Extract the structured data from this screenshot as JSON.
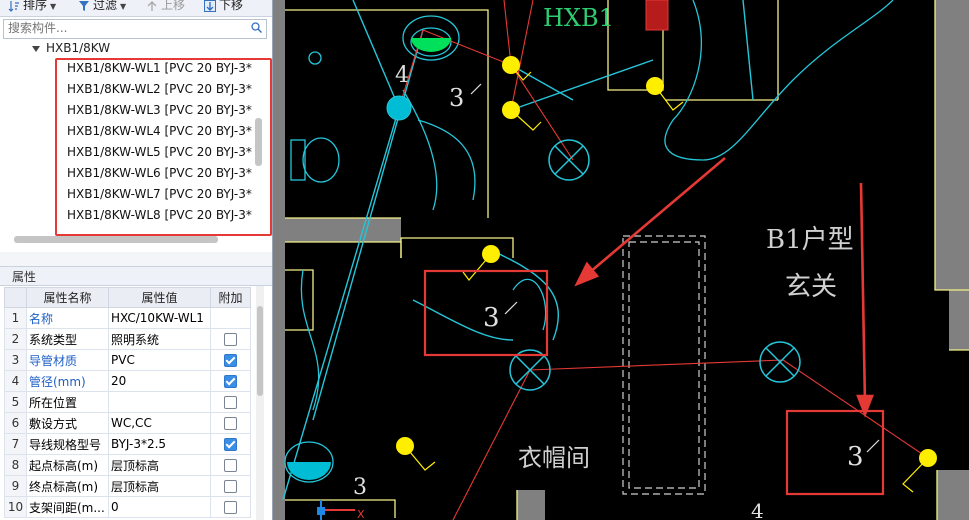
{
  "toolbar": {
    "sort_label": "排序",
    "filter_label": "过滤",
    "move_up_label": "上移",
    "move_down_label": "下移"
  },
  "search": {
    "placeholder": "搜索构件..."
  },
  "tree": {
    "root_label": "HXB1/8KW",
    "items": [
      {
        "label": "HXB1/8KW-WL1 [PVC 20 BYJ-3*"
      },
      {
        "label": "HXB1/8KW-WL2 [PVC 20 BYJ-3*"
      },
      {
        "label": "HXB1/8KW-WL3 [PVC 20 BYJ-3*"
      },
      {
        "label": "HXB1/8KW-WL4 [PVC 20 BYJ-3*"
      },
      {
        "label": "HXB1/8KW-WL5 [PVC 20 BYJ-3*"
      },
      {
        "label": "HXB1/8KW-WL6 [PVC 20 BYJ-3*"
      },
      {
        "label": "HXB1/8KW-WL7 [PVC 20 BYJ-3*"
      },
      {
        "label": "HXB1/8KW-WL8 [PVC 20 BYJ-3*"
      }
    ]
  },
  "properties": {
    "panel_title": "属性",
    "columns": [
      "属性名称",
      "属性值",
      "附加"
    ],
    "rows": [
      {
        "num": "1",
        "name": "名称",
        "value": "HXC/10KW-WL1",
        "checked": null,
        "blue": true
      },
      {
        "num": "2",
        "name": "系统类型",
        "value": "照明系统",
        "checked": false,
        "blue": false
      },
      {
        "num": "3",
        "name": "导管材质",
        "value": "PVC",
        "checked": true,
        "blue": true
      },
      {
        "num": "4",
        "name": "管径(mm)",
        "value": "20",
        "checked": true,
        "blue": true
      },
      {
        "num": "5",
        "name": "所在位置",
        "value": "",
        "checked": false,
        "blue": false
      },
      {
        "num": "6",
        "name": "敷设方式",
        "value": "WC,CC",
        "checked": false,
        "blue": false
      },
      {
        "num": "7",
        "name": "导线规格型号",
        "value": "BYJ-3*2.5",
        "checked": true,
        "blue": false
      },
      {
        "num": "8",
        "name": "起点标高(m)",
        "value": "层顶标高",
        "checked": false,
        "blue": false
      },
      {
        "num": "9",
        "name": "终点标高(m)",
        "value": "层顶标高",
        "checked": false,
        "blue": false
      },
      {
        "num": "10",
        "name": "支架间距(m...",
        "value": "0",
        "checked": false,
        "blue": false
      }
    ]
  },
  "cad": {
    "panel_label": "HXB1",
    "room_type_label": "B1户型",
    "room_entrance_label": "玄关",
    "room_closet_label": "衣帽间",
    "fixture_number_3": "3",
    "fixture_number_4": "4",
    "axis_x_label": "X",
    "colors": {
      "wall": "#f5f08a",
      "wire_cyan": "#26c6da",
      "wire_red": "#e53935",
      "lamp_yellow": "#ffee00",
      "annotation_red": "#e53935",
      "gray_wall": "#808080"
    }
  }
}
